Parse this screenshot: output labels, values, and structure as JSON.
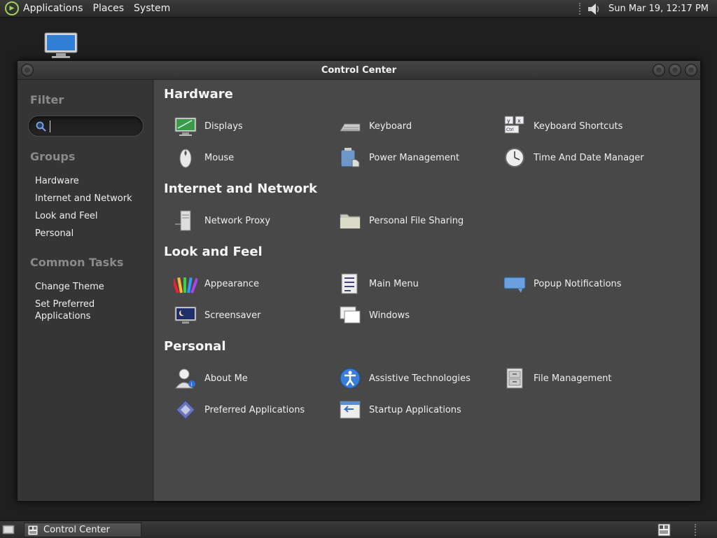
{
  "top_panel": {
    "menus": [
      "Applications",
      "Places",
      "System"
    ],
    "clock": "Sun Mar 19, 12:17 PM"
  },
  "window": {
    "title": "Control Center"
  },
  "sidebar": {
    "filter_heading": "Filter",
    "search": {
      "value": "",
      "placeholder": ""
    },
    "groups_heading": "Groups",
    "groups": [
      "Hardware",
      "Internet and Network",
      "Look and Feel",
      "Personal"
    ],
    "tasks_heading": "Common Tasks",
    "tasks": [
      "Change Theme",
      "Set Preferred Applications"
    ]
  },
  "content": {
    "groups": [
      {
        "title": "Hardware",
        "items": [
          {
            "label": "Displays",
            "icon": "display-icon"
          },
          {
            "label": "Keyboard",
            "icon": "keyboard-icon"
          },
          {
            "label": "Keyboard Shortcuts",
            "icon": "keyboard-shortcuts-icon"
          },
          {
            "label": "Mouse",
            "icon": "mouse-icon"
          },
          {
            "label": "Power Management",
            "icon": "power-management-icon"
          },
          {
            "label": "Time And Date Manager",
            "icon": "clock-icon"
          }
        ]
      },
      {
        "title": "Internet and Network",
        "items": [
          {
            "label": "Network Proxy",
            "icon": "network-proxy-icon"
          },
          {
            "label": "Personal File Sharing",
            "icon": "folder-share-icon"
          }
        ]
      },
      {
        "title": "Look and Feel",
        "items": [
          {
            "label": "Appearance",
            "icon": "appearance-icon"
          },
          {
            "label": "Main Menu",
            "icon": "main-menu-icon"
          },
          {
            "label": "Popup Notifications",
            "icon": "popup-notification-icon"
          },
          {
            "label": "Screensaver",
            "icon": "screensaver-icon"
          },
          {
            "label": "Windows",
            "icon": "windows-icon"
          }
        ]
      },
      {
        "title": "Personal",
        "items": [
          {
            "label": "About Me",
            "icon": "about-me-icon"
          },
          {
            "label": "Assistive Technologies",
            "icon": "accessibility-icon"
          },
          {
            "label": "File Management",
            "icon": "file-cabinet-icon"
          },
          {
            "label": "Preferred Applications",
            "icon": "preferred-apps-icon"
          },
          {
            "label": "Startup Applications",
            "icon": "startup-apps-icon"
          }
        ]
      }
    ]
  },
  "taskbar": {
    "task_label": "Control Center"
  }
}
